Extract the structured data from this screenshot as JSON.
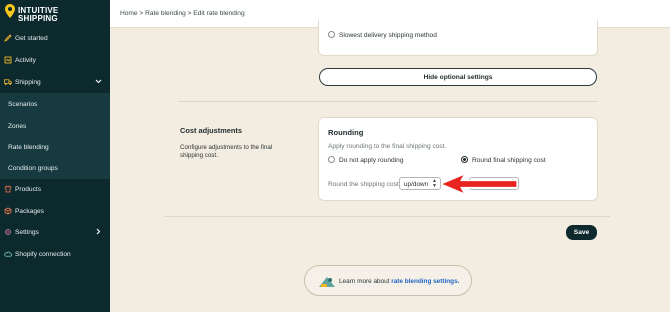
{
  "brand": {
    "line1": "INTUITIVE",
    "line2": "SHIPPING"
  },
  "sidebar": {
    "items": [
      {
        "label": "Get started",
        "icon": "rocket-icon"
      },
      {
        "label": "Activity",
        "icon": "activity-icon"
      },
      {
        "label": "Shipping",
        "icon": "truck-icon"
      },
      {
        "label": "Scenarios"
      },
      {
        "label": "Zones"
      },
      {
        "label": "Rate blending"
      },
      {
        "label": "Condition groups"
      },
      {
        "label": "Products",
        "icon": "shirt-icon"
      },
      {
        "label": "Packages",
        "icon": "box-icon"
      },
      {
        "label": "Settings",
        "icon": "gear-icon"
      },
      {
        "label": "Shopify connection",
        "icon": "cloud-icon"
      }
    ]
  },
  "breadcrumb": "Home > Rate blending > Edit rate blending",
  "optional": {
    "slowest_label": "Slowest delivery shipping method",
    "hide_button": "Hide optional settings"
  },
  "cost_adjustments": {
    "title": "Cost adjustments",
    "description_line1": "Configure adjustments to the final",
    "description_line2": "shipping cost."
  },
  "rounding": {
    "title": "Rounding",
    "subtitle": "Apply rounding to the final shipping cost.",
    "option_no": "Do not apply rounding",
    "option_round": "Round final shipping cost",
    "selected": "Round final shipping cost",
    "round_label": "Round the shipping cost",
    "direction_value": "up/down",
    "arrow_color": "#e8251f"
  },
  "save_label": "Save",
  "learn": {
    "prefix": "Learn more about",
    "link": "rate blending settings."
  }
}
